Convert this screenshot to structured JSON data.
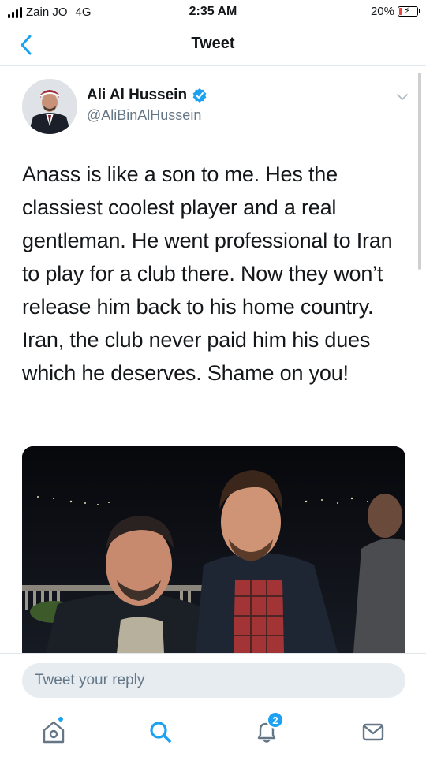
{
  "status_bar": {
    "carrier": "Zain JO",
    "network": "4G",
    "time": "2:35 AM",
    "battery_percent_label": "20%",
    "battery_level": 0.2
  },
  "nav": {
    "title": "Tweet",
    "back_icon": "chevron-left-icon"
  },
  "tweet": {
    "author_name": "Ali Al Hussein",
    "verified": true,
    "handle": "@AliBinAlHussein",
    "text": "Anass is like a son to me. Hes the classiest coolest player and a real gentleman. He went professional to Iran to play for a club there. Now they won’t release him back to his home country. Iran, the club never paid him his dues which he deserves. Shame on you!",
    "media_icon": "photo-two-men-night"
  },
  "reply": {
    "placeholder": "Tweet your reply"
  },
  "tab_bar": {
    "items": [
      {
        "icon": "home-icon",
        "active_dot": true
      },
      {
        "icon": "search-icon"
      },
      {
        "icon": "notifications-icon",
        "badge": "2"
      },
      {
        "icon": "messages-icon"
      }
    ]
  },
  "colors": {
    "accent": "#1da1f2",
    "text_primary": "#14171a",
    "text_secondary": "#657786",
    "reply_background": "#e6ecf0",
    "battery_low": "#e8463f"
  }
}
